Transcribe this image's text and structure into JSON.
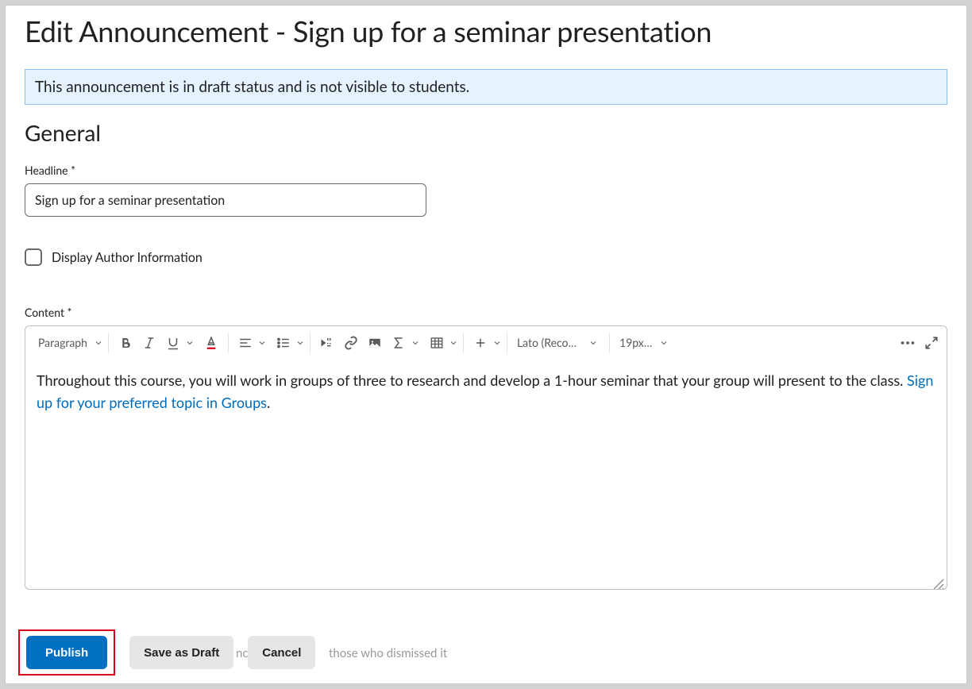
{
  "page_title": "Edit Announcement - Sign up for a seminar presentation",
  "banner_text": "This announcement is in draft status and is not visible to students.",
  "section_heading": "General",
  "headline_label": "Headline *",
  "headline_value": "Sign up for a seminar presentation",
  "author_checkbox_label": "Display Author Information",
  "content_label": "Content *",
  "toolbar": {
    "block_format": "Paragraph",
    "font_family": "Lato (Recom…",
    "font_size": "19px …"
  },
  "editor": {
    "text": "Throughout this course, you will work in groups of three to research and develop a 1-hour seminar that your group will present to the class. ",
    "link_text": "Sign up for your preferred topic in Groups",
    "period": "."
  },
  "buttons": {
    "publish": "Publish",
    "save_draft": "Save as Draft",
    "cancel": "Cancel"
  },
  "ghost": {
    "g1": "nc",
    "g2": "those who dismissed it"
  }
}
